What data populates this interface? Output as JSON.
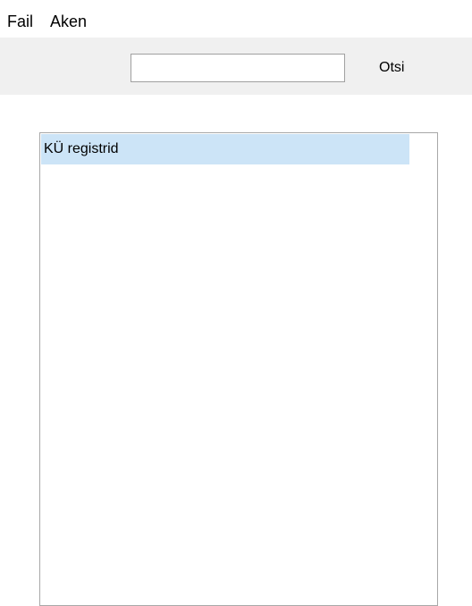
{
  "menubar": {
    "items": [
      {
        "label": "Fail"
      },
      {
        "label": "Aken"
      }
    ]
  },
  "toolbar": {
    "search": {
      "value": "",
      "placeholder": ""
    },
    "search_button_label": "Otsi"
  },
  "list": {
    "items": [
      {
        "label": "KÜ registrid",
        "selected": true
      }
    ]
  },
  "colors": {
    "selection": "#cce4f7",
    "toolbar_bg": "#f0f0f0",
    "border": "#a8a8a8"
  }
}
